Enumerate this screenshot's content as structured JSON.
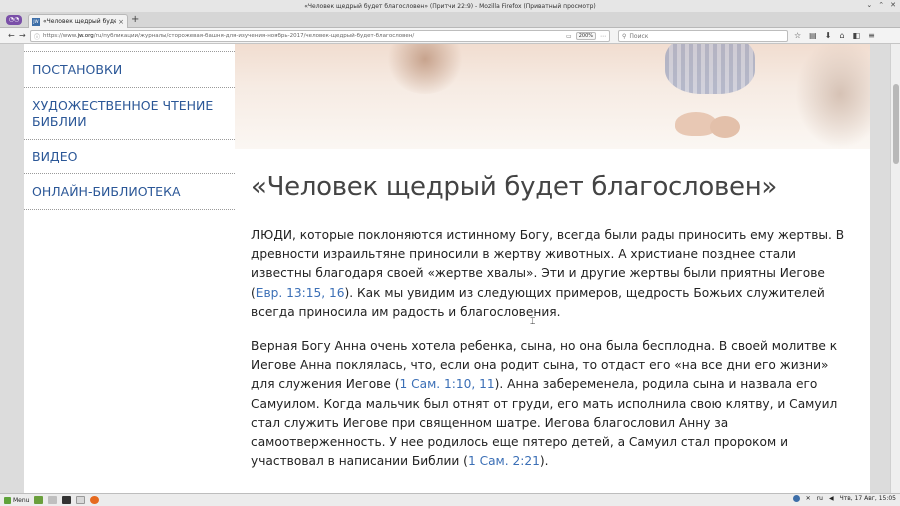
{
  "window": {
    "title": "«Человек щедрый будет благословен» (Притчи 22:9) - Mozilla Firefox (Приватный просмотр)",
    "controls": [
      "⌄",
      "⌃",
      "✕"
    ]
  },
  "tab": {
    "label": "«Человек щедрый будет б",
    "close": "×",
    "new_tab": "+"
  },
  "nav": {
    "back": "←",
    "forward": "→",
    "url_prefix": "https://www.",
    "url_domain": "jw.org",
    "url_path": "/ru/публикации/журналы/сторожевая-башня-для-изучения-ноябрь-2017/человек-щедрый-будет-благословен/",
    "zoom": "200%",
    "search_placeholder": "Поиск",
    "tools": [
      "☆",
      "▤",
      "⬇",
      "⌂",
      "◧",
      "≡"
    ]
  },
  "sidebar": {
    "items": [
      {
        "label": "ПОСТАНОВКИ"
      },
      {
        "label": "ХУДОЖЕСТВЕННОЕ ЧТЕНИЕ БИБЛИИ"
      },
      {
        "label": "ВИДЕО"
      },
      {
        "label": "ОНЛАЙН-БИБЛИОТЕКА"
      }
    ]
  },
  "article": {
    "title": "«Человек щедрый будет благословен»",
    "p1_a": "ЛЮДИ, которые поклоняются истинному Богу, всегда были рады приносить ему жертвы. В древности израильтяне приносили в жертву животных. А христиане позднее стали известны благодаря своей «жертве хвалы». Эти и другие жертвы были приятны Иегове (",
    "p1_ref": "Евр. 13:15, 16",
    "p1_b": "). Как мы увидим из следующих примеров, щедрость Божьих служителей всегда приносила им радость и благословения.",
    "p2_a": "Верная Богу Анна очень хотела ребенка, сына, но она была бесплодна. В своей молитве к Иегове Анна поклялась, что, если она родит сына, то отдаст его «на все дни его жизни» для служения Иегове (",
    "p2_ref1": "1 Сам. 1:10, 11",
    "p2_b": "). Анна забеременела, родила сына и назвала его Самуилом. Когда мальчик был отнят от груди, его мать исполнила свою клятву, и Самуил стал служить Иегове при священном шатре. Иегова благословил Анну за самоотверженность. У нее родилось еще пятеро детей, а Самуил стал пророком и участвовал в написании Библии (",
    "p2_ref2": "1 Сам. 2:21",
    "p2_c": ")."
  },
  "taskbar": {
    "menu": "Menu",
    "lang": "ru",
    "clock": "Чтв, 17 Авг, 15:05"
  },
  "colors": {
    "link": "#3b6fb6",
    "sidebar_link": "#2b5797",
    "heading": "#444444"
  }
}
